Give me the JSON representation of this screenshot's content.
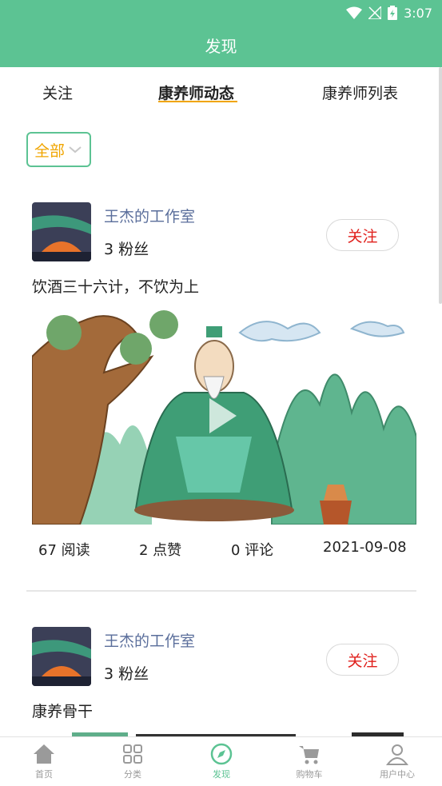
{
  "status_bar": {
    "time": "3:07"
  },
  "header": {
    "title": "发现"
  },
  "tabs": [
    {
      "label": "关注"
    },
    {
      "label": "康养师动态"
    },
    {
      "label": "康养师列表"
    }
  ],
  "filter": {
    "label": "全部"
  },
  "posts": [
    {
      "author": "王杰的工作室",
      "fans": "3 粉丝",
      "follow_label": "关注",
      "text": "饮酒三十六计，不饮为上",
      "reads": "67 阅读",
      "likes": "2 点赞",
      "comments": "0 评论",
      "date": "2021-09-08"
    },
    {
      "author": "王杰的工作室",
      "fans": "3 粉丝",
      "follow_label": "关注",
      "text": "康养骨干"
    }
  ],
  "bottom_nav": [
    {
      "label": "首页"
    },
    {
      "label": "分类"
    },
    {
      "label": "发现"
    },
    {
      "label": "购物车"
    },
    {
      "label": "用户中心"
    }
  ],
  "colors": {
    "brand": "#5cc393",
    "accent": "#f0a500",
    "follow": "#e0201c",
    "link": "#5a6e9b"
  }
}
